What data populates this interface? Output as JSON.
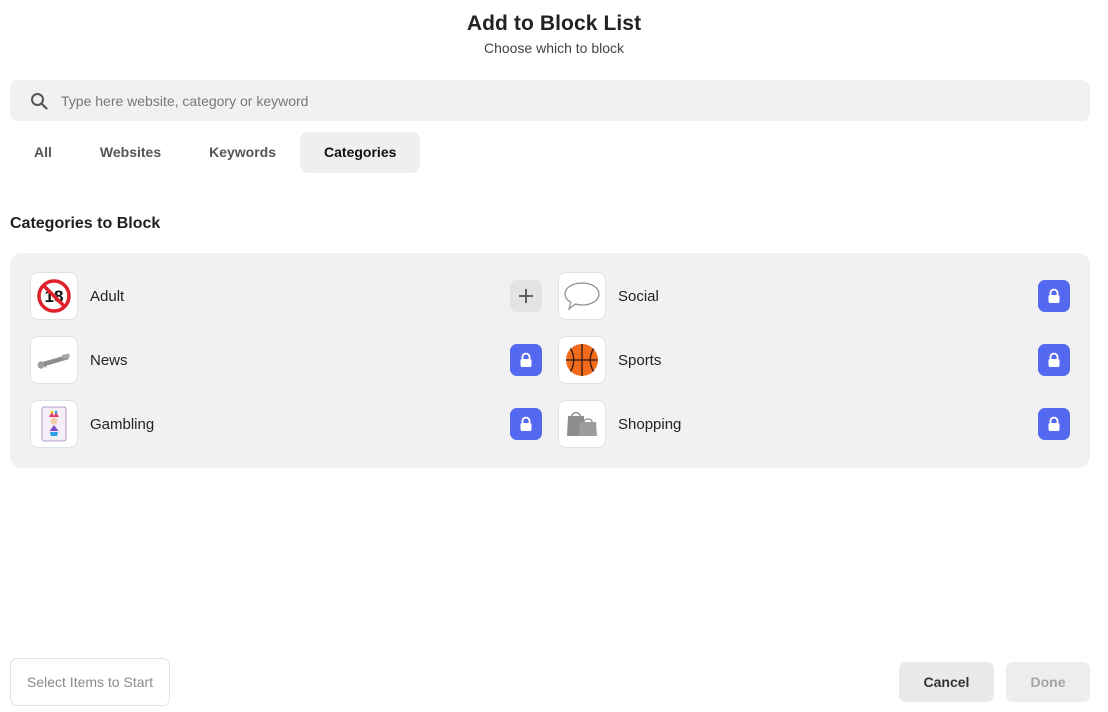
{
  "header": {
    "title": "Add to Block List",
    "subtitle": "Choose which to block"
  },
  "search": {
    "icon": "search-icon",
    "placeholder": "Type here website, category or keyword",
    "value": ""
  },
  "tabs": [
    {
      "label": "All",
      "active": false
    },
    {
      "label": "Websites",
      "active": false
    },
    {
      "label": "Keywords",
      "active": false
    },
    {
      "label": "Categories",
      "active": true
    }
  ],
  "section": {
    "title": "Categories to Block"
  },
  "categories": [
    {
      "label": "Adult",
      "icon": "no-under-18-icon",
      "action": "add"
    },
    {
      "label": "Social",
      "icon": "speech-bubble-icon",
      "action": "locked"
    },
    {
      "label": "News",
      "icon": "rolled-newspaper-icon",
      "action": "locked"
    },
    {
      "label": "Sports",
      "icon": "basketball-icon",
      "action": "locked"
    },
    {
      "label": "Gambling",
      "icon": "joker-card-icon",
      "action": "locked"
    },
    {
      "label": "Shopping",
      "icon": "shopping-bags-icon",
      "action": "locked"
    }
  ],
  "footer": {
    "status": "Select Items to Start",
    "cancel_label": "Cancel",
    "done_label": "Done"
  },
  "colors": {
    "accent": "#5468f0",
    "panel_bg": "#f1f1f1",
    "done_disabled_text": "#a4a4a4"
  }
}
